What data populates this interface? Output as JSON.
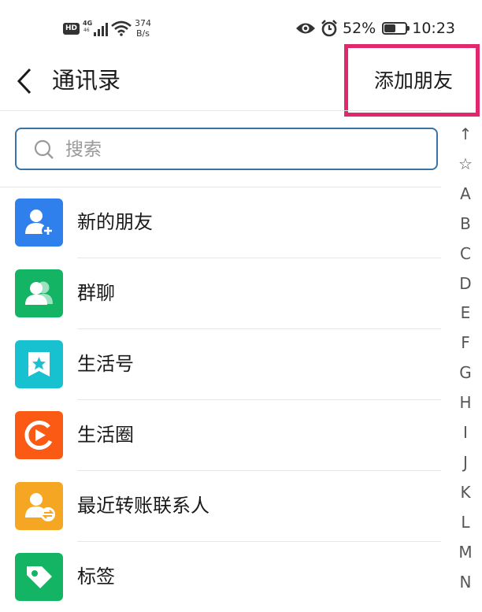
{
  "status_bar": {
    "hd": "HD",
    "network": "4G",
    "network_sub": "46",
    "speed_value": "374",
    "speed_unit": "B/s",
    "battery_percent": 0.52,
    "battery_text": "52%",
    "time": "10:23"
  },
  "header": {
    "title": "通讯录",
    "add_friend": "添加朋友"
  },
  "search": {
    "placeholder": "搜索"
  },
  "list": {
    "items": [
      {
        "label": "新的朋友",
        "icon": "add-contact-icon",
        "color": "#2f80ed"
      },
      {
        "label": "群聊",
        "icon": "group-icon",
        "color": "#13b565"
      },
      {
        "label": "生活号",
        "icon": "star-bookmark-icon",
        "color": "#17c1cf"
      },
      {
        "label": "生活圈",
        "icon": "play-circle-icon",
        "color": "#fa5a14"
      },
      {
        "label": "最近转账联系人",
        "icon": "transfer-contact-icon",
        "color": "#f5a623"
      },
      {
        "label": "标签",
        "icon": "tag-icon",
        "color": "#13b565"
      }
    ]
  },
  "alphabet_index": [
    "↑",
    "☆",
    "A",
    "B",
    "C",
    "D",
    "E",
    "F",
    "G",
    "H",
    "I",
    "J",
    "K",
    "L",
    "M",
    "N"
  ]
}
